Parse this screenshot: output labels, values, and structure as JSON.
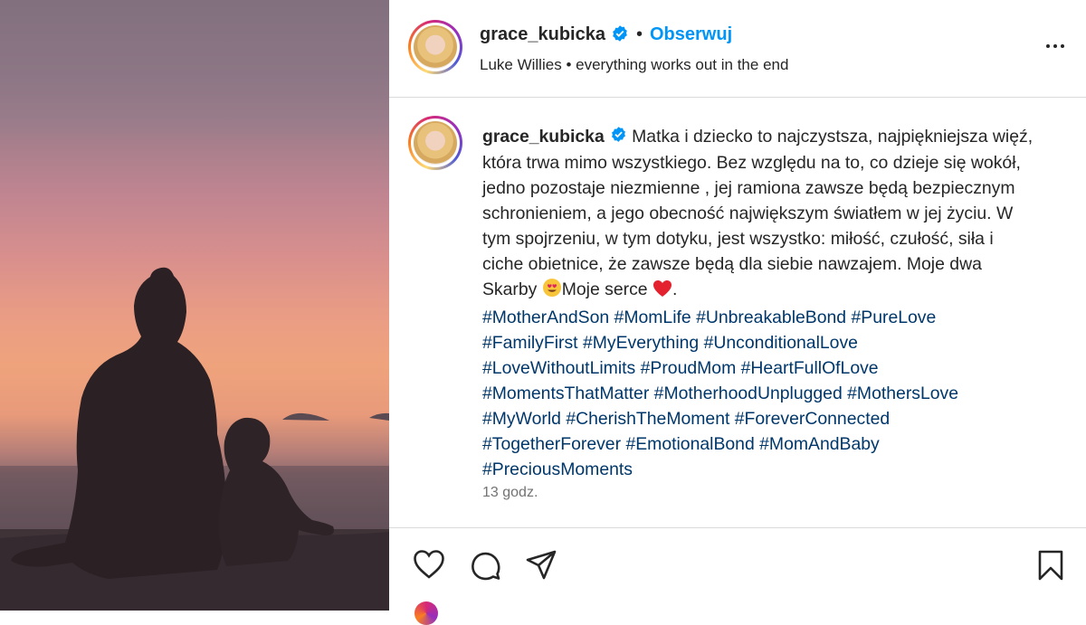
{
  "post": {
    "username": "grace_kubicka",
    "follow_label": "Obserwuj",
    "separator": "•",
    "audio_artist": "Luke Willies",
    "audio_separator": "•",
    "audio_track": "everything works out in the end",
    "caption_text": "Matka i dziecko to najczystsza, najpiękniejsza więź, która trwa mimo wszystkiego. Bez względu na to, co dzieje się wokół, jedno pozostaje niezmienne , jej ramiona zawsze będą bezpiecznym schronieniem, a jego obecność największym światłem w jej życiu. W tym spojrzeniu, w tym dotyku, jest wszystko: miłość, czułość, siła i ciche obietnice, że zawsze będą dla siebie nawzajem. Moje dwa Skarby",
    "caption_mid": "Moje serce",
    "caption_end": ".",
    "hashtags": [
      "#MotherAndSon",
      "#MomLife",
      "#UnbreakableBond",
      "#PureLove",
      "#FamilyFirst",
      "#MyEverything",
      "#UnconditionalLove",
      "#LoveWithoutLimits",
      "#ProudMom",
      "#HeartFullOfLove",
      "#MomentsThatMatter",
      "#MotherhoodUnplugged",
      "#MothersLove",
      "#MyWorld",
      "#CherishTheMoment",
      "#ForeverConnected",
      "#TogetherForever",
      "#EmotionalBond",
      "#MomAndBaby",
      "#PreciousMoments"
    ],
    "timestamp": "13 godz."
  },
  "icons": {
    "verified": "verified-badge-icon",
    "more": "more-options-icon",
    "like": "heart-icon",
    "comment": "comment-icon",
    "share": "send-icon",
    "save": "bookmark-icon",
    "emoji_eyes": "heart-eyes-emoji",
    "emoji_heart": "red-heart-emoji"
  },
  "colors": {
    "link_blue": "#0095f6",
    "hashtag_blue": "#00376b",
    "verified_blue": "#0095f6"
  }
}
